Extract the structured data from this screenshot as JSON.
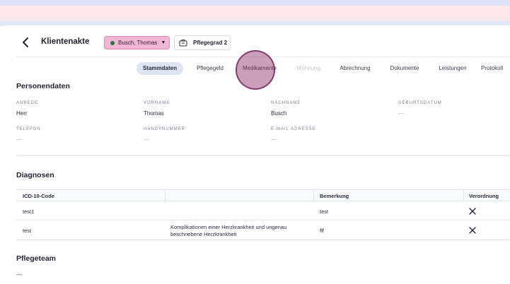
{
  "header": {
    "title": "Klientenakte",
    "client_name": "Busch, Thomas",
    "pflegegrad": "Pflegegrad 2"
  },
  "tabs": [
    {
      "label": "Stammdaten",
      "state": "active"
    },
    {
      "label": "Pflegegeld",
      "state": "normal"
    },
    {
      "label": "Medikamente",
      "state": "normal"
    },
    {
      "label": "Wohnung",
      "state": "disabled"
    },
    {
      "label": "Abrechnung",
      "state": "normal"
    },
    {
      "label": "Dokumente",
      "state": "normal"
    },
    {
      "label": "Leistungen",
      "state": "normal"
    },
    {
      "label": "Protokoll",
      "state": "normal"
    }
  ],
  "personendaten": {
    "title": "Personendaten",
    "fields": [
      {
        "label": "ANREDE",
        "value": "Herr"
      },
      {
        "label": "VORNAME",
        "value": "Thomas"
      },
      {
        "label": "NACHNAME",
        "value": "Busch"
      },
      {
        "label": "GEBURTSDATUM",
        "value": "---"
      },
      {
        "label": "TELEFON",
        "value": "---"
      },
      {
        "label": "HANDYNUMMER",
        "value": "---"
      },
      {
        "label": "E-MAIL ADRESSE",
        "value": "---"
      }
    ]
  },
  "diagnosen": {
    "title": "Diagnosen",
    "columns": [
      "ICD-10-Code",
      "",
      "Bemerkung",
      "Verordnung"
    ],
    "rows": [
      {
        "code": "test1",
        "description": "",
        "bemerkung": "test"
      },
      {
        "code": "test",
        "description": "Komplikationen einer Herzkrankheit und ungenau beschriebene Herzkrankheit",
        "bemerkung": "fff"
      }
    ]
  },
  "pflegeteam": {
    "title": "Pflegeteam",
    "value": "---"
  },
  "colors": {
    "accent_chip": "#f3b6d5",
    "active_tab": "#dde5f3",
    "status_dot": "#1f7a3a"
  },
  "icons": {
    "back": "chevron-left-icon",
    "status": "status-dot-icon",
    "dropdown": "caret-down-icon",
    "pflegegrad": "briefcase-icon",
    "remove": "close-icon"
  }
}
